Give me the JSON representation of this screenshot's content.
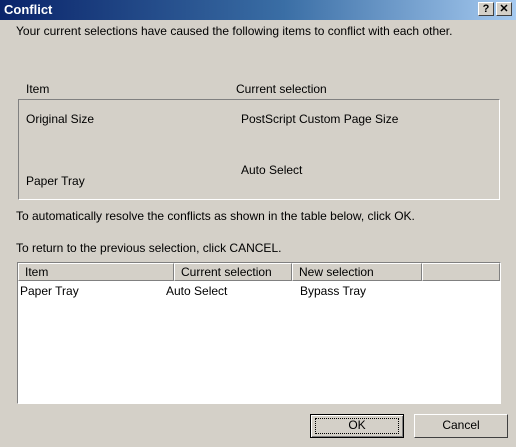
{
  "window": {
    "title": "Conflict",
    "help_glyph": "?",
    "close_glyph": "✕"
  },
  "intro_text": "Your current selections have caused the following items to conflict with each other.",
  "conflict_group": {
    "header_item": "Item",
    "header_current": "Current selection",
    "rows": [
      {
        "item": "Original Size",
        "current": "PostScript Custom Page Size"
      },
      {
        "item": "Paper Tray",
        "current": "Auto Select"
      }
    ]
  },
  "instructions": {
    "ok_text": "To automatically resolve the conflicts as shown in the table below, click OK.",
    "cancel_text": "To return to the previous selection, click CANCEL."
  },
  "resolution_table": {
    "columns": [
      "Item",
      "Current selection",
      "New selection",
      ""
    ],
    "rows": [
      {
        "item": "Paper Tray",
        "current": "Auto Select",
        "new": "Bypass Tray"
      }
    ]
  },
  "buttons": {
    "ok": "OK",
    "cancel": "Cancel"
  }
}
